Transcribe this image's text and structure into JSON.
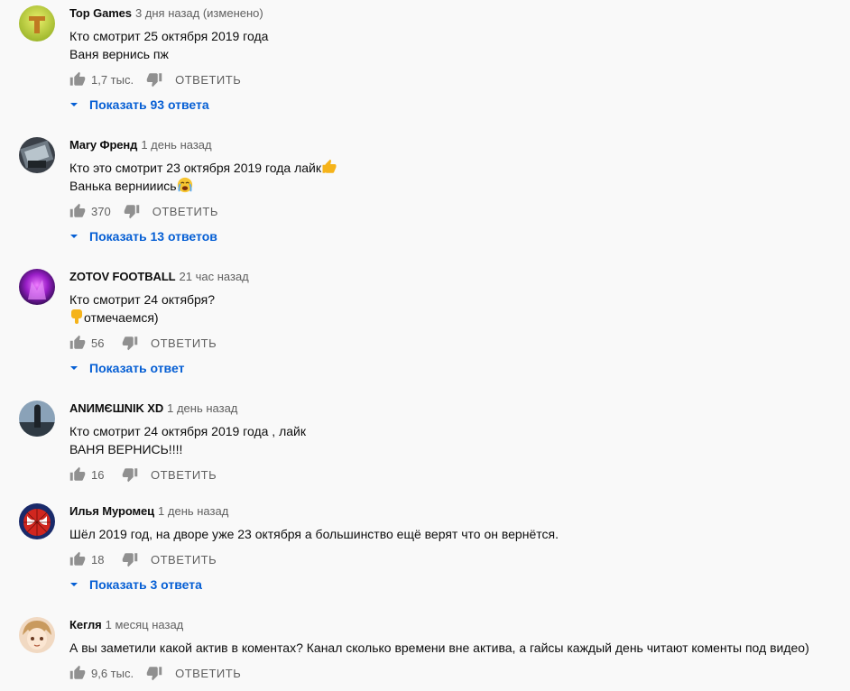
{
  "reply_label": "ОТВЕТИТЬ",
  "colors": {
    "link": "#065fd4",
    "muted": "#606060",
    "text": "#0d0d0d",
    "background": "#f9f9f9"
  },
  "icons": [
    "thumb-up-icon",
    "thumb-down-icon",
    "caret-down-icon",
    "thumbs-up-emoji",
    "crying-emoji",
    "point-down-emoji"
  ],
  "comments": [
    {
      "author": "Top Games",
      "time": "3 дня назад (изменено)",
      "lines": [
        "Кто смотрит 25 октября 2019 года",
        "Ваня вернись пж"
      ],
      "likes": "1,7 тыс.",
      "replies": "Показать 93 ответа"
    },
    {
      "author": "Mary Френд",
      "time": "1 день назад",
      "lines": [
        "Кто это смотрит 23 октября 2019 года лайк",
        "Ванька вернииись"
      ],
      "likes": "370",
      "replies": "Показать 13 ответов"
    },
    {
      "author": "ZOTOV FOOTBALL",
      "time": "21 час назад",
      "lines": [
        "Кто смотрит 24 октября?",
        "отмечаемся)"
      ],
      "likes": "56",
      "replies": "Показать ответ"
    },
    {
      "author": "ANИMЄШNIK XD",
      "time": "1 день назад",
      "lines": [
        "Кто смотрит 24 октября 2019 года , лайк",
        "ВАНЯ ВЕРНИСЬ!!!!"
      ],
      "likes": "16",
      "replies": ""
    },
    {
      "author": "Илья Муромец",
      "time": "1 день назад",
      "lines": [
        "Шёл 2019 год, на дворе уже 23 октября а большинство ещё верят что он вернётся."
      ],
      "likes": "18",
      "replies": "Показать 3 ответа"
    },
    {
      "author": "Кегля",
      "time": "1 месяц назад",
      "lines": [
        "А вы заметили какой актив в коментах? Канал сколько времени вне актива, а гайсы каждый день читают коменты под видео)"
      ],
      "likes": "9,6 тыс.",
      "replies": ""
    }
  ]
}
